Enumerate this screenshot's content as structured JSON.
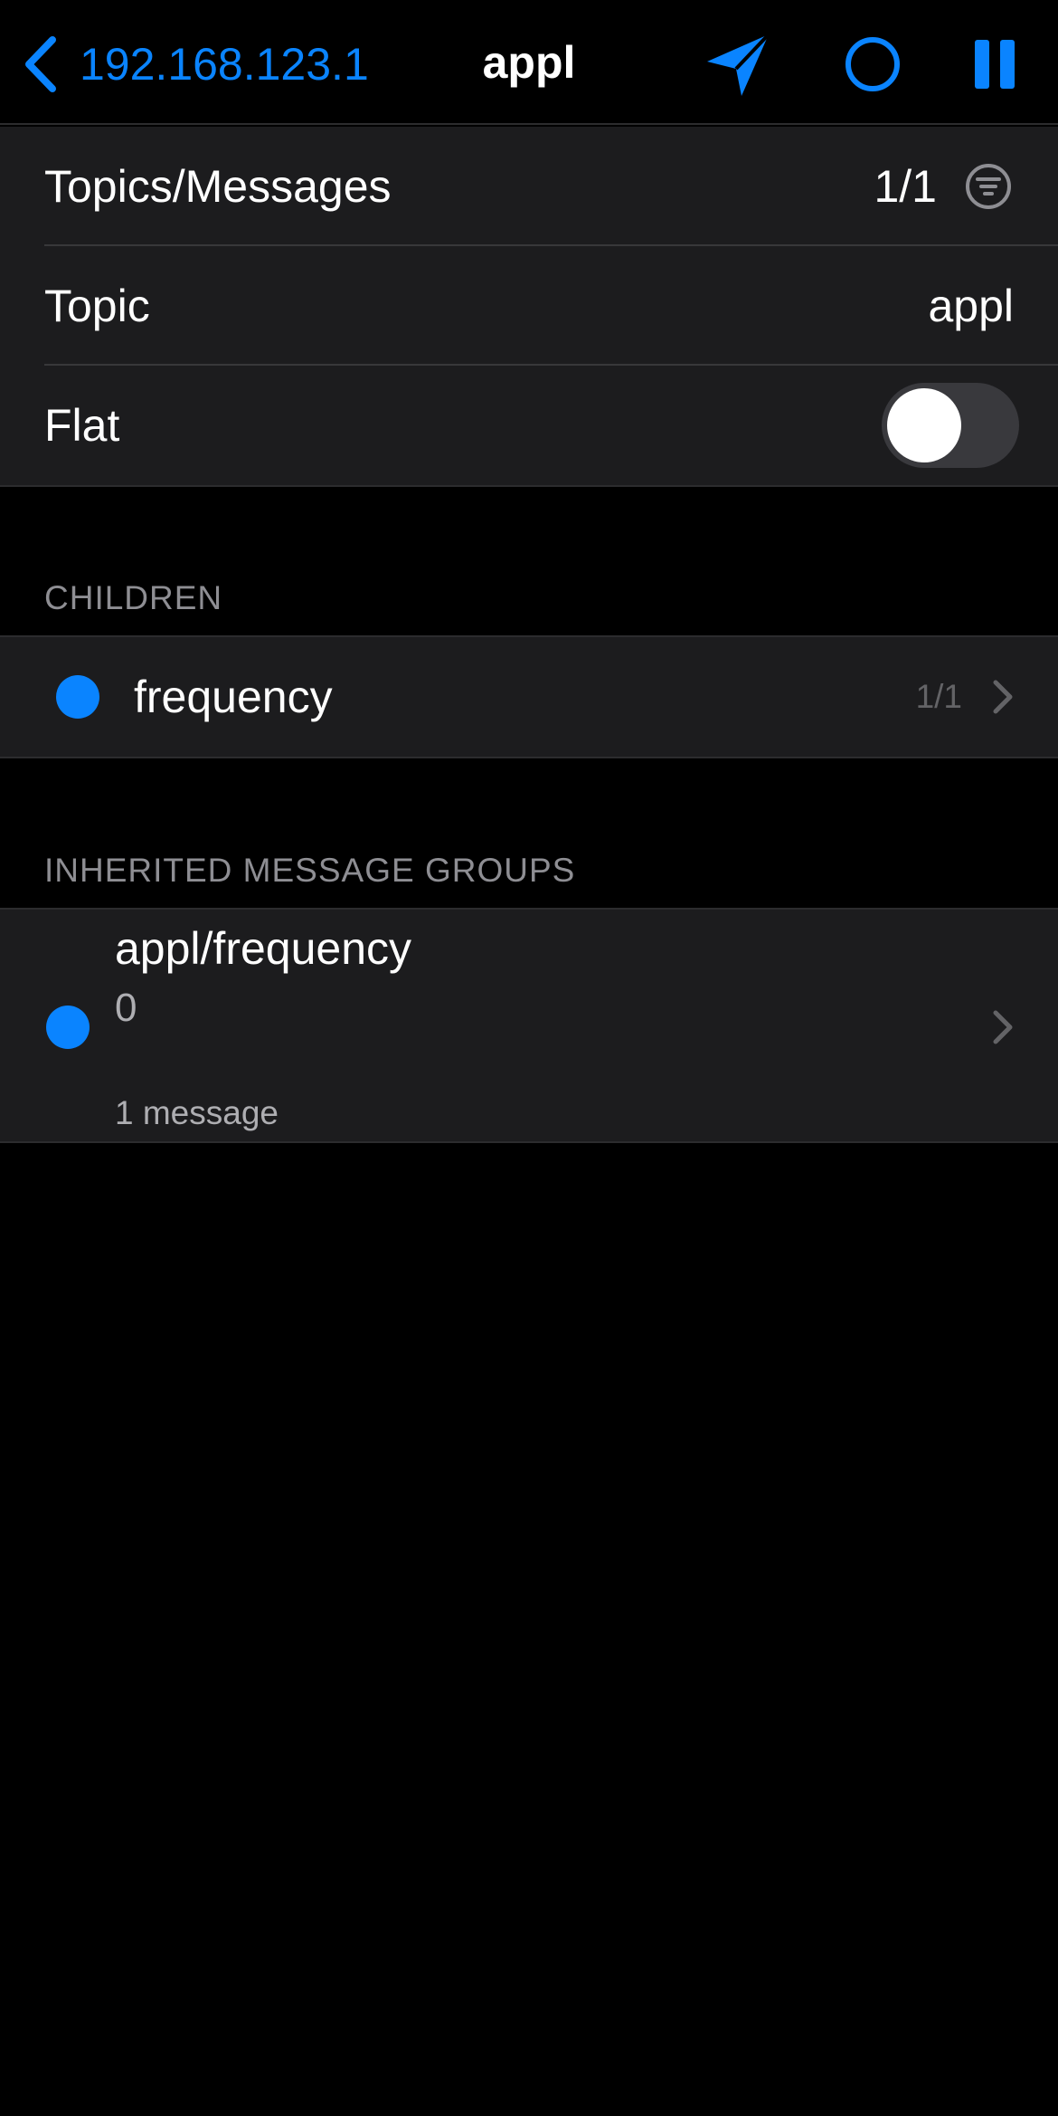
{
  "navbar": {
    "back_label": "192.168.123.1",
    "title": "appl",
    "icons": [
      "send-icon",
      "record-icon",
      "pause-icon"
    ],
    "accent_color": "#0a84ff"
  },
  "settings": {
    "topics_messages": {
      "label": "Topics/Messages",
      "value": "1/1"
    },
    "topic": {
      "label": "Topic",
      "value": "appl"
    },
    "flat": {
      "label": "Flat",
      "enabled": false
    }
  },
  "children": {
    "header": "CHILDREN",
    "items": [
      {
        "label": "frequency",
        "count": "1/1"
      }
    ]
  },
  "inherited": {
    "header": "INHERITED MESSAGE GROUPS",
    "items": [
      {
        "title": "appl/frequency",
        "value": "0",
        "meta": "1 message"
      }
    ]
  }
}
